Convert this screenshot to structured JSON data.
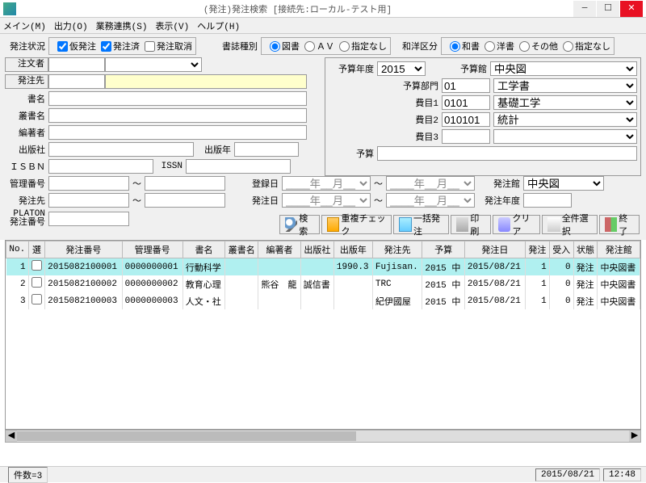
{
  "window": {
    "title": "(発注)発注検索 [接続先:ローカル-テスト用]"
  },
  "menu": [
    "メイン(M)",
    "出力(O)",
    "業務連携(S)",
    "表示(V)",
    "ヘルプ(H)"
  ],
  "labels": {
    "order_status": "発注状況",
    "kari": "仮発注",
    "sumi": "発注済",
    "torikeshi": "発注取消",
    "shoshi_shubetsu": "書誌種別",
    "tosho": "図書",
    "av": "ＡＶ",
    "shitei_nashi": "指定なし",
    "wayo": "和洋区分",
    "washo": "和書",
    "yosho": "洋書",
    "sonota": "その他",
    "chumon": "注文者",
    "hacchu_saki": "発注先",
    "shomei": "書名",
    "sousho": "叢書名",
    "hensha": "編著者",
    "shuppansha": "出版社",
    "shuppan_nen": "出版年",
    "isbn": "ＩＳＢＮ",
    "issn": "ISSN",
    "kanri": "管理番号",
    "platon": "PLATON\n発注番号",
    "touroku": "登録日",
    "hacchubi": "発注日",
    "yosan_nendo": "予算年度",
    "yosankan": "予算館",
    "yosan_bumon": "予算部門",
    "himoku1": "費目1",
    "himoku2": "費目2",
    "himoku3": "費目3",
    "yosan": "予算",
    "hacchu_kan": "発注館",
    "hacchu_nendo": "発注年度",
    "tilde": "～",
    "date_blank": "____年__月__日"
  },
  "yosan_nendo_val": "2015",
  "yosankan_val": "中央図",
  "bumon": {
    "code": "01",
    "name": "工学書"
  },
  "himoku1": {
    "code": "0101",
    "name": "基礎工学"
  },
  "himoku2": {
    "code": "010101",
    "name": "統計"
  },
  "hacchu_kan_val": "中央図",
  "buttons": {
    "search": "検索",
    "dup": "重複チェック",
    "batch": "一括発注",
    "print": "印刷",
    "clear": "クリア",
    "selall": "全件選択",
    "exit": "終了"
  },
  "grid": {
    "headers": [
      "No.",
      "選",
      "発注番号",
      "管理番号",
      "書名",
      "叢書名",
      "編著者",
      "出版社",
      "出版年",
      "発注先",
      "予算",
      "発注日",
      "発注",
      "受入",
      "状態",
      "発注館"
    ],
    "rows": [
      {
        "no": "1",
        "sel": "",
        "ono": "2015082100001",
        "kno": "0000000001",
        "title": "行動科学",
        "sou": "",
        "auth": "",
        "pub": "",
        "py": "1990.3",
        "dest": "Fujisan.",
        "bud": "2015 中",
        "odate": "2015/08/21",
        "oc": "1",
        "rc": "0",
        "st": "発注",
        "kan": "中央図書"
      },
      {
        "no": "2",
        "sel": "",
        "ono": "2015082100002",
        "kno": "0000000002",
        "title": "教育心理",
        "sou": "",
        "auth": "熊谷　龍",
        "pub": "誠信書",
        "py": "",
        "dest": "TRC",
        "bud": "2015 中",
        "odate": "2015/08/21",
        "oc": "1",
        "rc": "0",
        "st": "発注",
        "kan": "中央図書"
      },
      {
        "no": "3",
        "sel": "",
        "ono": "2015082100003",
        "kno": "0000000003",
        "title": "人文・社",
        "sou": "",
        "auth": "",
        "pub": "",
        "py": "",
        "dest": "紀伊國屋",
        "bud": "2015 中",
        "odate": "2015/08/21",
        "oc": "1",
        "rc": "0",
        "st": "発注",
        "kan": "中央図書"
      }
    ]
  },
  "status": {
    "count": "件数=3",
    "date": "2015/08/21",
    "time": "12:48"
  }
}
